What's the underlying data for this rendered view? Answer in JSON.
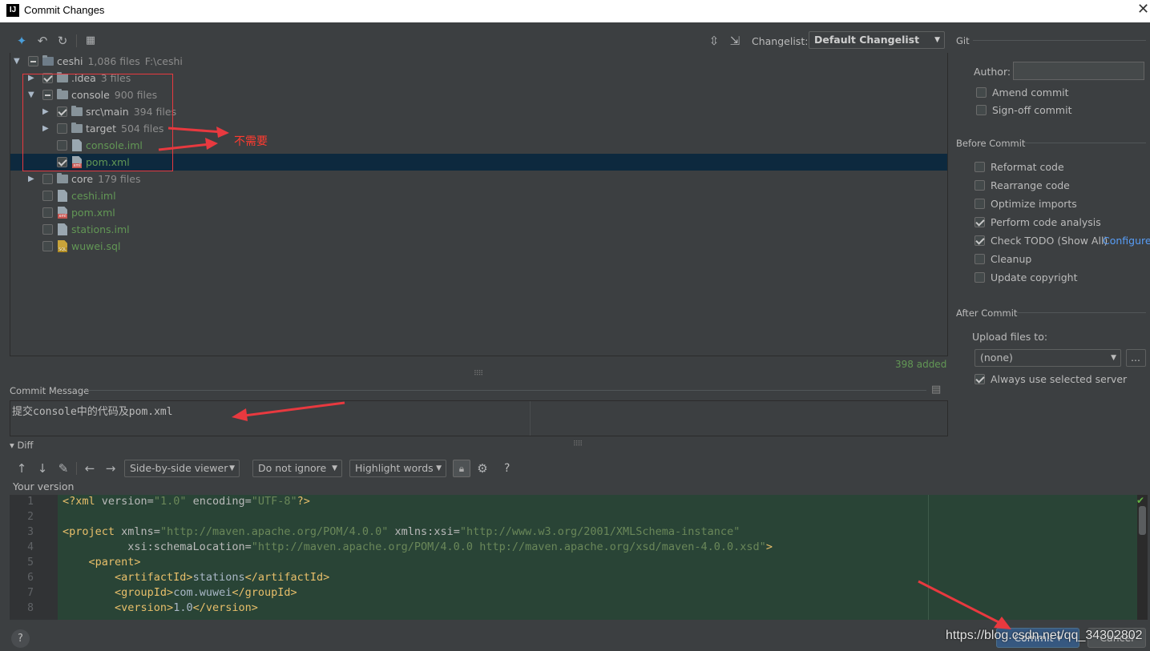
{
  "window": {
    "title": "Commit Changes",
    "logo": "IJ"
  },
  "toolbar": {
    "icons": [
      "diff-icon",
      "rollback-icon",
      "refresh-icon",
      "group-by-icon"
    ],
    "changelist_label": "Changelist:",
    "changelist_value": "Default Changelist"
  },
  "tree": {
    "root": {
      "name": "ceshi",
      "count": "1,086 files",
      "path": "F:\\ceshi"
    },
    "rows": [
      {
        "name": ".idea",
        "count": "3 files"
      },
      {
        "name": "console",
        "count": "900 files"
      },
      {
        "name": "src\\main",
        "count": "394 files"
      },
      {
        "name": "target",
        "count": "504 files"
      },
      {
        "name": "console.iml"
      },
      {
        "name": "pom.xml"
      },
      {
        "name": "core",
        "count": "179 files"
      },
      {
        "name": "ceshi.iml"
      },
      {
        "name": "pom.xml"
      },
      {
        "name": "stations.iml"
      },
      {
        "name": "wuwei.sql"
      }
    ],
    "status": "398 added"
  },
  "annotation": {
    "note": "不需要",
    "color": "#e8393f"
  },
  "git": {
    "title": "Git",
    "author_label": "Author:",
    "author_value": "",
    "amend": "Amend commit",
    "signoff": "Sign-off commit"
  },
  "before_commit": {
    "title": "Before Commit",
    "options": [
      {
        "label": "Reformat code",
        "checked": false
      },
      {
        "label": "Rearrange code",
        "checked": false
      },
      {
        "label": "Optimize imports",
        "checked": false
      },
      {
        "label": "Perform code analysis",
        "checked": true
      },
      {
        "label": "Check TODO (Show All)",
        "checked": true,
        "link": "Configure"
      },
      {
        "label": "Cleanup",
        "checked": false
      },
      {
        "label": "Update copyright",
        "checked": false
      }
    ]
  },
  "after_commit": {
    "title": "After Commit",
    "upload_label": "Upload files to:",
    "upload_value": "(none)",
    "more_button": "...",
    "always_use": "Always use selected server"
  },
  "commit_message": {
    "label": "Commit Message",
    "text": "提交console中的代码及pom.xml"
  },
  "diff": {
    "title": "Diff",
    "viewer": "Side-by-side viewer",
    "ignore": "Do not ignore",
    "highlight": "Highlight words",
    "help": "?",
    "your_version": "Your version",
    "line_numbers": [
      "1",
      "2",
      "3",
      "4",
      "5",
      "6",
      "7",
      "8"
    ]
  },
  "footer": {
    "help": "?",
    "commit": "Commit",
    "cancel": "Cancel",
    "watermark": "https://blog.csdn.net/qq_34302802"
  },
  "colors": {
    "accent": "#589df6",
    "selection": "#0d293e",
    "added_bg": "#294436",
    "green_text": "#629755"
  }
}
